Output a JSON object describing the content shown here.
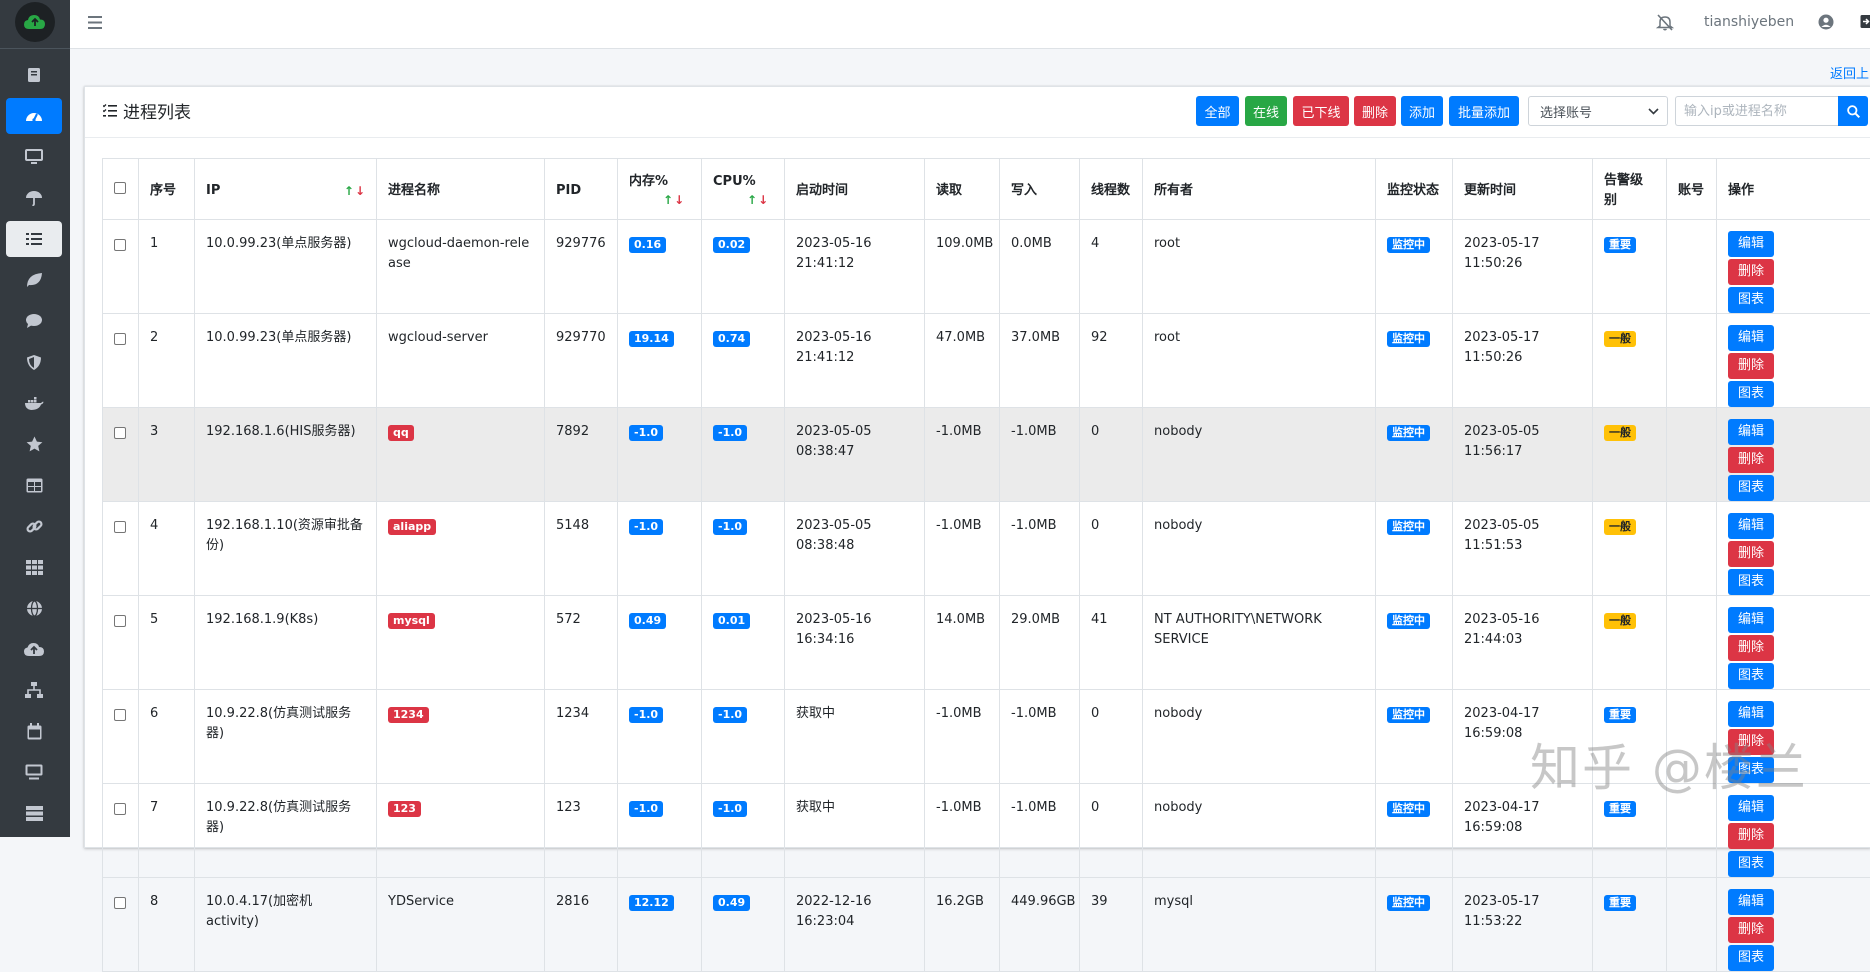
{
  "topbar": {
    "username": "tianshiyeben"
  },
  "back_link": "返回上",
  "card": {
    "title": "进程列表",
    "buttons": {
      "all": "全部",
      "online": "在线",
      "offline": "已下线",
      "delete": "删除",
      "add": "添加",
      "batch_add": "批量添加"
    },
    "account_select": {
      "selected": "选择账号"
    },
    "search": {
      "placeholder": "输入ip或进程名称"
    }
  },
  "table": {
    "headers": {
      "seq": "序号",
      "ip": "IP",
      "name": "进程名称",
      "pid": "PID",
      "mem": "内存%",
      "cpu": "CPU%",
      "start": "启动时间",
      "read": "读取",
      "write": "写入",
      "threads": "线程数",
      "owner": "所有者",
      "monitor": "监控状态",
      "updated": "更新时间",
      "alert": "告警级别",
      "account": "账号",
      "ops": "操作"
    },
    "rows": [
      {
        "seq": "1",
        "ip": "10.0.99.23(单点服务器)",
        "name": "wgcloud-daemon-release",
        "name_badge": false,
        "pid": "929776",
        "mem": "0.16",
        "cpu": "0.02",
        "start": "2023-05-16 21:41:12",
        "read": "109.0MB",
        "write": "0.0MB",
        "threads": "4",
        "owner": "root",
        "monitor": "监控中",
        "updated": "2023-05-17 11:50:26",
        "alert": "重要",
        "alert_color": "#007bff",
        "has_chart": true
      },
      {
        "seq": "2",
        "ip": "10.0.99.23(单点服务器)",
        "name": "wgcloud-server",
        "name_badge": false,
        "pid": "929770",
        "mem": "19.14",
        "cpu": "0.74",
        "start": "2023-05-16 21:41:12",
        "read": "47.0MB",
        "write": "37.0MB",
        "threads": "92",
        "owner": "root",
        "monitor": "监控中",
        "updated": "2023-05-17 11:50:26",
        "alert": "一般",
        "alert_color": "#ffc107",
        "has_chart": true
      },
      {
        "seq": "3",
        "ip": "192.168.1.6(HIS服务器)",
        "name": "qq",
        "name_badge": true,
        "pid": "7892",
        "mem": "-1.0",
        "cpu": "-1.0",
        "start": "2023-05-05 08:38:47",
        "read": "-1.0MB",
        "write": "-1.0MB",
        "threads": "0",
        "owner": "nobody",
        "monitor": "监控中",
        "updated": "2023-05-05 11:56:17",
        "alert": "一般",
        "alert_color": "#ffc107",
        "has_chart": true
      },
      {
        "seq": "4",
        "ip": "192.168.1.10(资源审批备份)",
        "name": "aliapp",
        "name_badge": true,
        "pid": "5148",
        "mem": "-1.0",
        "cpu": "-1.0",
        "start": "2023-05-05 08:38:48",
        "read": "-1.0MB",
        "write": "-1.0MB",
        "threads": "0",
        "owner": "nobody",
        "monitor": "监控中",
        "updated": "2023-05-05 11:51:53",
        "alert": "一般",
        "alert_color": "#ffc107",
        "has_chart": true
      },
      {
        "seq": "5",
        "ip": "192.168.1.9(K8s)",
        "name": "mysql",
        "name_badge": true,
        "pid": "572",
        "mem": "0.49",
        "cpu": "0.01",
        "start": "2023-05-16 16:34:16",
        "read": "14.0MB",
        "write": "29.0MB",
        "threads": "41",
        "owner": "NT AUTHORITY\\NETWORK SERVICE",
        "monitor": "监控中",
        "updated": "2023-05-16 21:44:03",
        "alert": "一般",
        "alert_color": "#ffc107",
        "has_chart": true
      },
      {
        "seq": "6",
        "ip": "10.9.22.8(仿真测试服务器)",
        "name": "1234",
        "name_badge": true,
        "pid": "1234",
        "mem": "-1.0",
        "cpu": "-1.0",
        "start": "获取中",
        "read": "-1.0MB",
        "write": "-1.0MB",
        "threads": "0",
        "owner": "nobody",
        "monitor": "监控中",
        "updated": "2023-04-17 16:59:08",
        "alert": "重要",
        "alert_color": "#007bff",
        "has_chart": true
      },
      {
        "seq": "7",
        "ip": "10.9.22.8(仿真测试服务器)",
        "name": "123",
        "name_badge": true,
        "pid": "123",
        "mem": "-1.0",
        "cpu": "-1.0",
        "start": "获取中",
        "read": "-1.0MB",
        "write": "-1.0MB",
        "threads": "0",
        "owner": "nobody",
        "monitor": "监控中",
        "updated": "2023-04-17 16:59:08",
        "alert": "重要",
        "alert_color": "#007bff",
        "has_chart": true
      },
      {
        "seq": "8",
        "ip": "10.0.4.17(加密机activity)",
        "name": "YDService",
        "name_badge": false,
        "pid": "2816",
        "mem": "12.12",
        "cpu": "0.49",
        "start": "2022-12-16 16:23:04",
        "read": "16.2GB",
        "write": "449.96GB",
        "threads": "39",
        "owner": "mysql",
        "monitor": "监控中",
        "updated": "2023-05-17 11:53:22",
        "alert": "重要",
        "alert_color": "#007bff",
        "has_chart": true
      }
    ],
    "op_labels": {
      "edit": "编辑",
      "delete": "删除",
      "chart": "图表"
    }
  },
  "watermark": "知乎 @楼兰",
  "icons": {
    "sidebar": [
      "book-icon",
      "dashboard-icon",
      "desktop-icon",
      "umbrella-icon",
      "list-icon",
      "leaf-icon",
      "comment-icon",
      "shield-icon",
      "docker-icon",
      "star-icon",
      "table-icon",
      "link-icon",
      "grid-icon",
      "globe-icon",
      "cloud-upload-icon",
      "network-icon",
      "calendar-icon",
      "monitor-icon",
      "server-icon"
    ]
  }
}
